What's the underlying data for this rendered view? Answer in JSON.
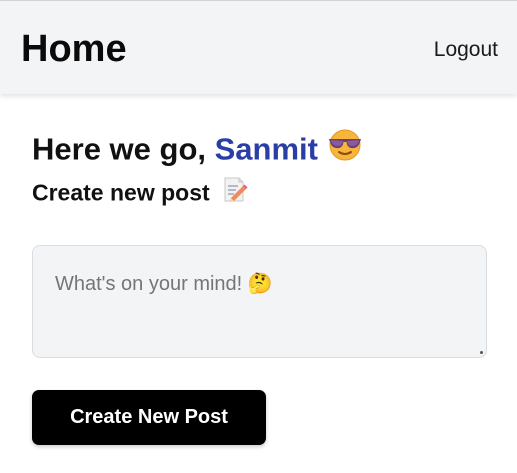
{
  "header": {
    "title": "Home",
    "logout_label": "Logout"
  },
  "greeting": {
    "prefix": "Here we go, ",
    "username": "Sanmit",
    "emoji_icon": "cool-sunglasses-face-icon"
  },
  "compose": {
    "heading": "Create new post",
    "heading_icon": "memo-pencil-icon",
    "placeholder": "What's on your mind! 🤔",
    "submit_label": "Create New Post"
  },
  "colors": {
    "header_bg": "#f3f4f6",
    "username": "#2a3fa6",
    "button_bg": "#000000",
    "button_text": "#ffffff",
    "input_bg": "#f3f4f6"
  }
}
